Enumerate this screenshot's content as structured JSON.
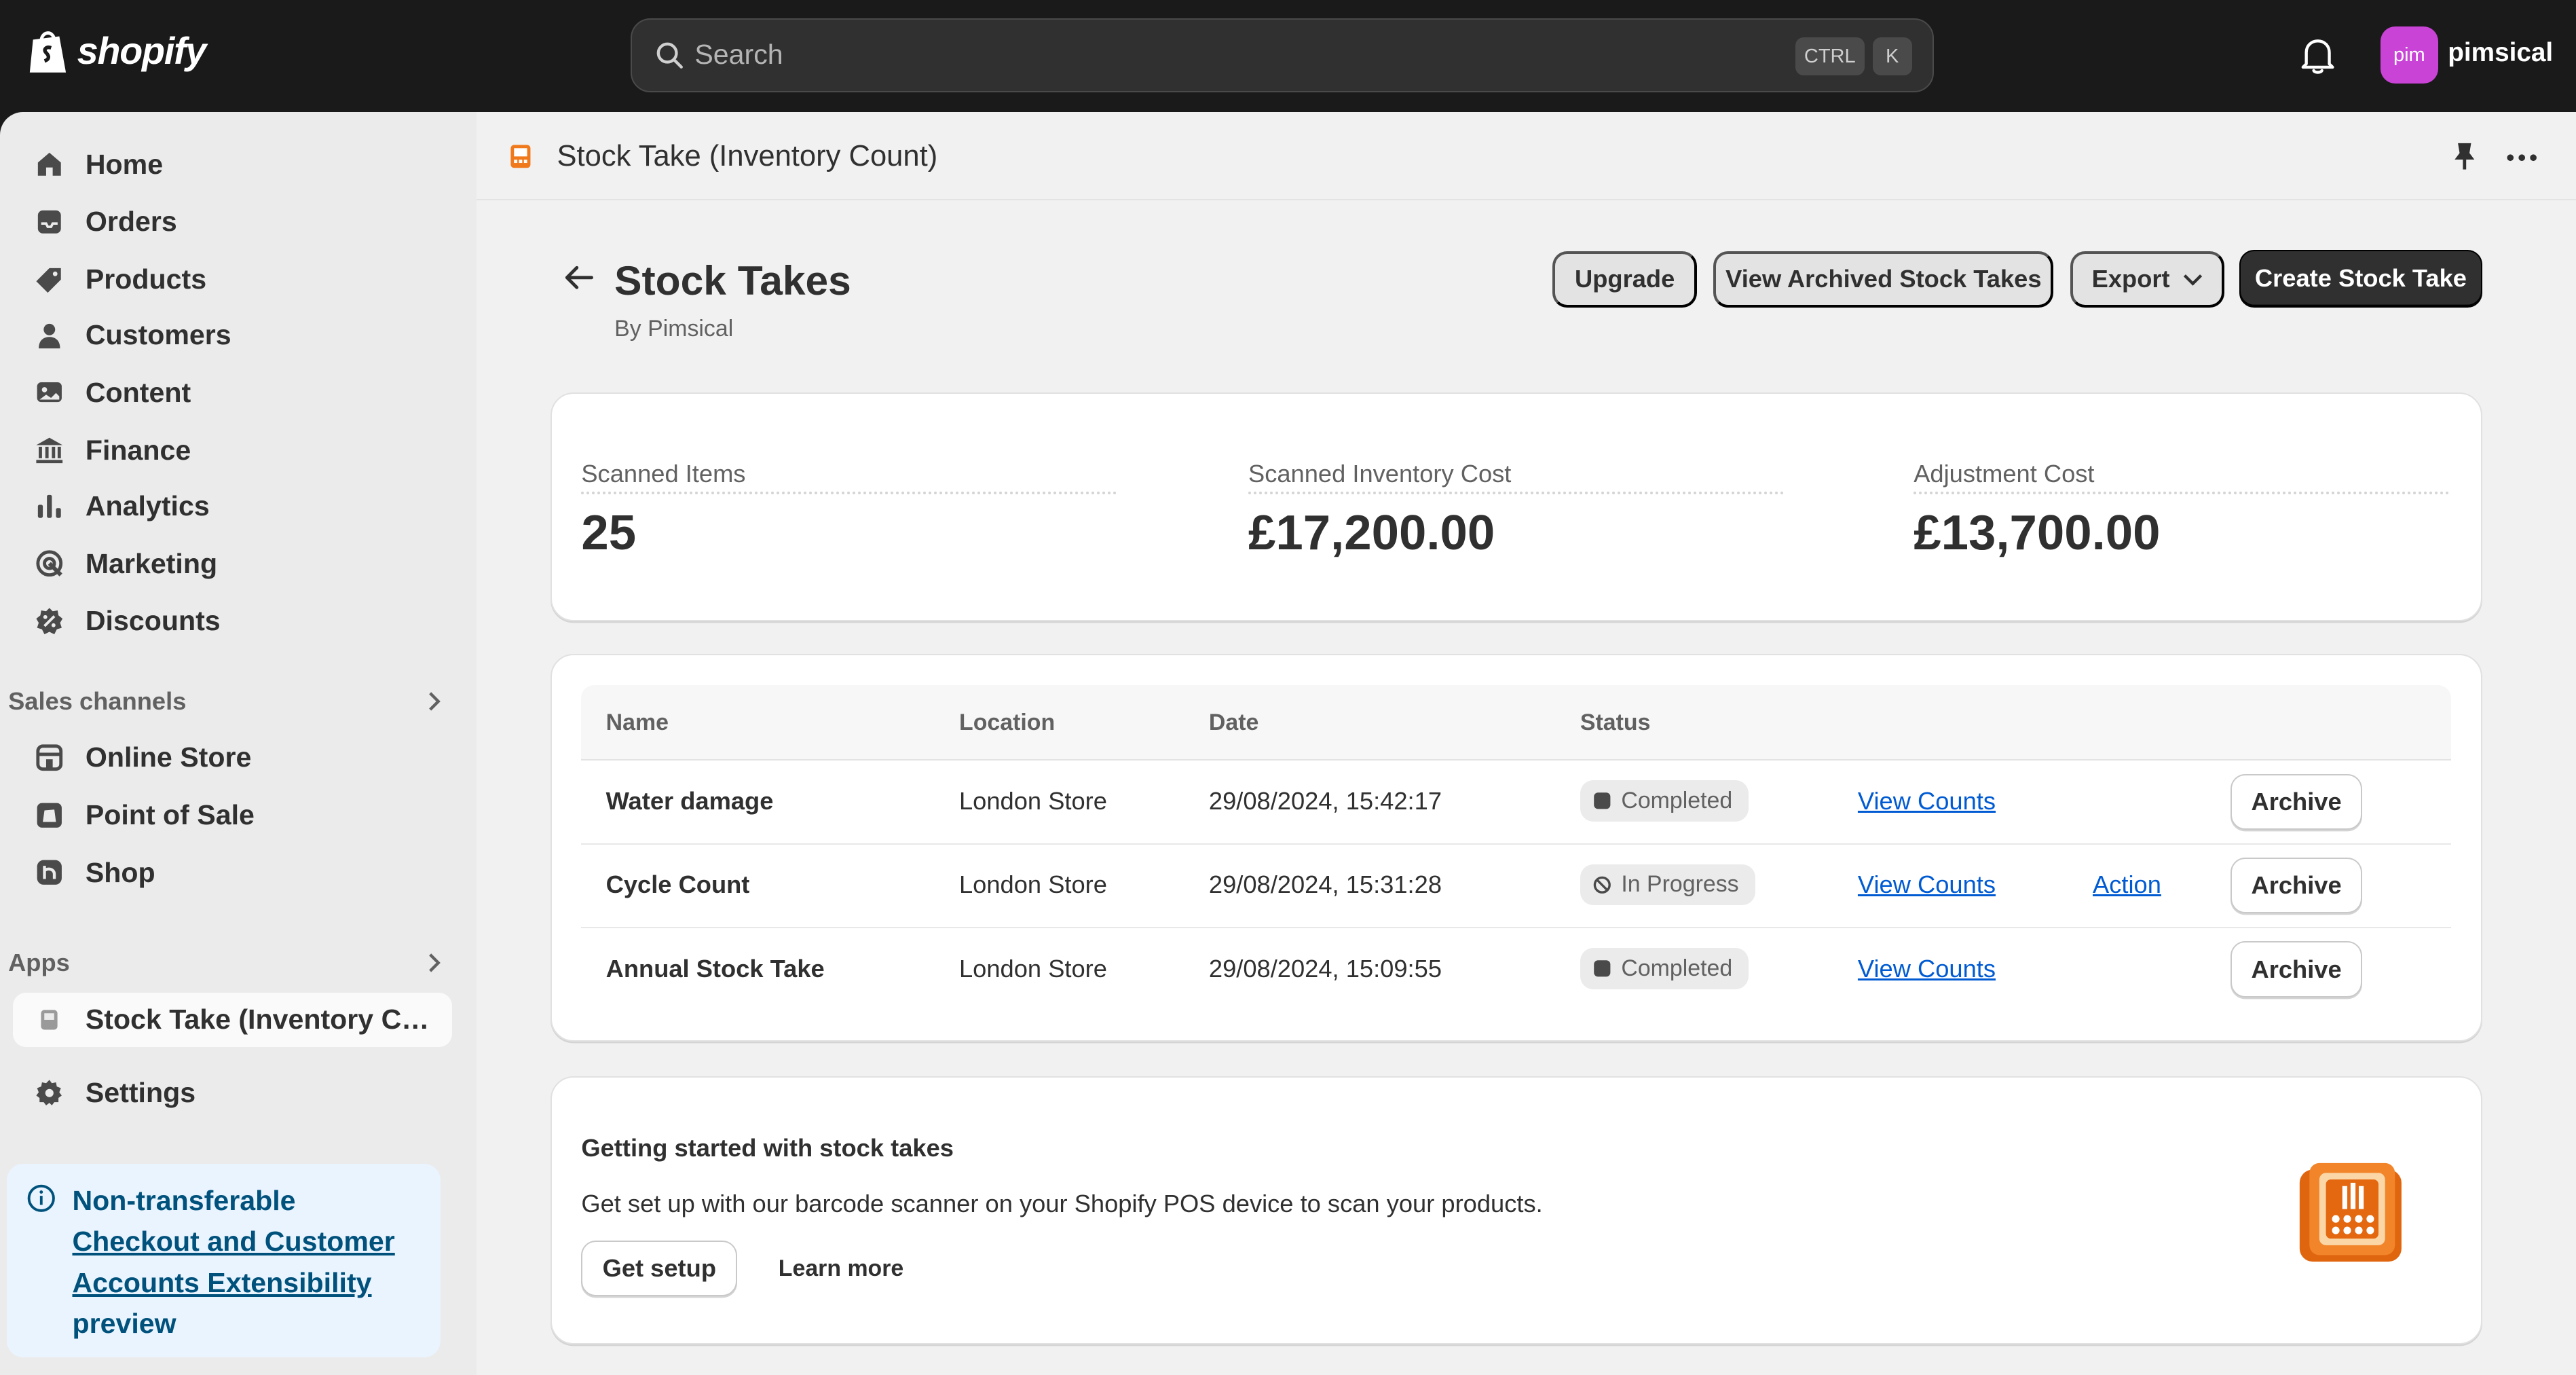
{
  "brand": {
    "name": "shopify"
  },
  "search": {
    "placeholder": "Search",
    "shortcut_ctrl": "CTRL",
    "shortcut_key": "K"
  },
  "user": {
    "initials": "pim",
    "name": "pimsical",
    "avatar_color": "#c843d6"
  },
  "sidebar": {
    "items": [
      {
        "label": "Home"
      },
      {
        "label": "Orders"
      },
      {
        "label": "Products"
      },
      {
        "label": "Customers"
      },
      {
        "label": "Content"
      },
      {
        "label": "Finance"
      },
      {
        "label": "Analytics"
      },
      {
        "label": "Marketing"
      },
      {
        "label": "Discounts"
      }
    ],
    "sales_channels": {
      "title": "Sales channels",
      "items": [
        {
          "label": "Online Store"
        },
        {
          "label": "Point of Sale"
        },
        {
          "label": "Shop"
        }
      ]
    },
    "apps": {
      "title": "Apps",
      "items": [
        {
          "label": "Stock Take (Inventory Count)"
        }
      ]
    },
    "settings": {
      "label": "Settings"
    },
    "notice": {
      "prefix": "Non-transferable",
      "link": "Checkout and Customer Accounts Extensibility",
      "suffix": "preview"
    }
  },
  "app_bar": {
    "title": "Stock Take (Inventory Count)"
  },
  "page": {
    "title": "Stock Takes",
    "subtitle": "By Pimsical",
    "actions": {
      "upgrade": "Upgrade",
      "view_archived": "View Archived Stock Takes",
      "export": "Export",
      "create": "Create Stock Take"
    }
  },
  "metrics": [
    {
      "label": "Scanned Items",
      "value": "25"
    },
    {
      "label": "Scanned Inventory Cost",
      "value": "£17,200.00"
    },
    {
      "label": "Adjustment Cost",
      "value": "£13,700.00"
    }
  ],
  "table": {
    "columns": {
      "name": "Name",
      "location": "Location",
      "date": "Date",
      "status": "Status"
    },
    "rows": [
      {
        "name": "Water damage",
        "location": "London Store",
        "date": "29/08/2024, 15:42:17",
        "status": "Completed",
        "view": "View Counts",
        "action": "",
        "archive": "Archive"
      },
      {
        "name": "Cycle Count",
        "location": "London Store",
        "date": "29/08/2024, 15:31:28",
        "status": "In Progress",
        "view": "View Counts",
        "action": "Action",
        "archive": "Archive"
      },
      {
        "name": "Annual Stock Take",
        "location": "London Store",
        "date": "29/08/2024, 15:09:55",
        "status": "Completed",
        "view": "View Counts",
        "action": "",
        "archive": "Archive"
      }
    ]
  },
  "getting_started": {
    "title": "Getting started with stock takes",
    "description": "Get set up with our barcode scanner on your Shopify POS device to scan your products.",
    "setup_button": "Get setup",
    "learn_more": "Learn more"
  },
  "colors": {
    "topbar": "#1a1a1a",
    "primary": "#303030",
    "link": "#005bd3",
    "app_icon": "#f07a1b"
  }
}
